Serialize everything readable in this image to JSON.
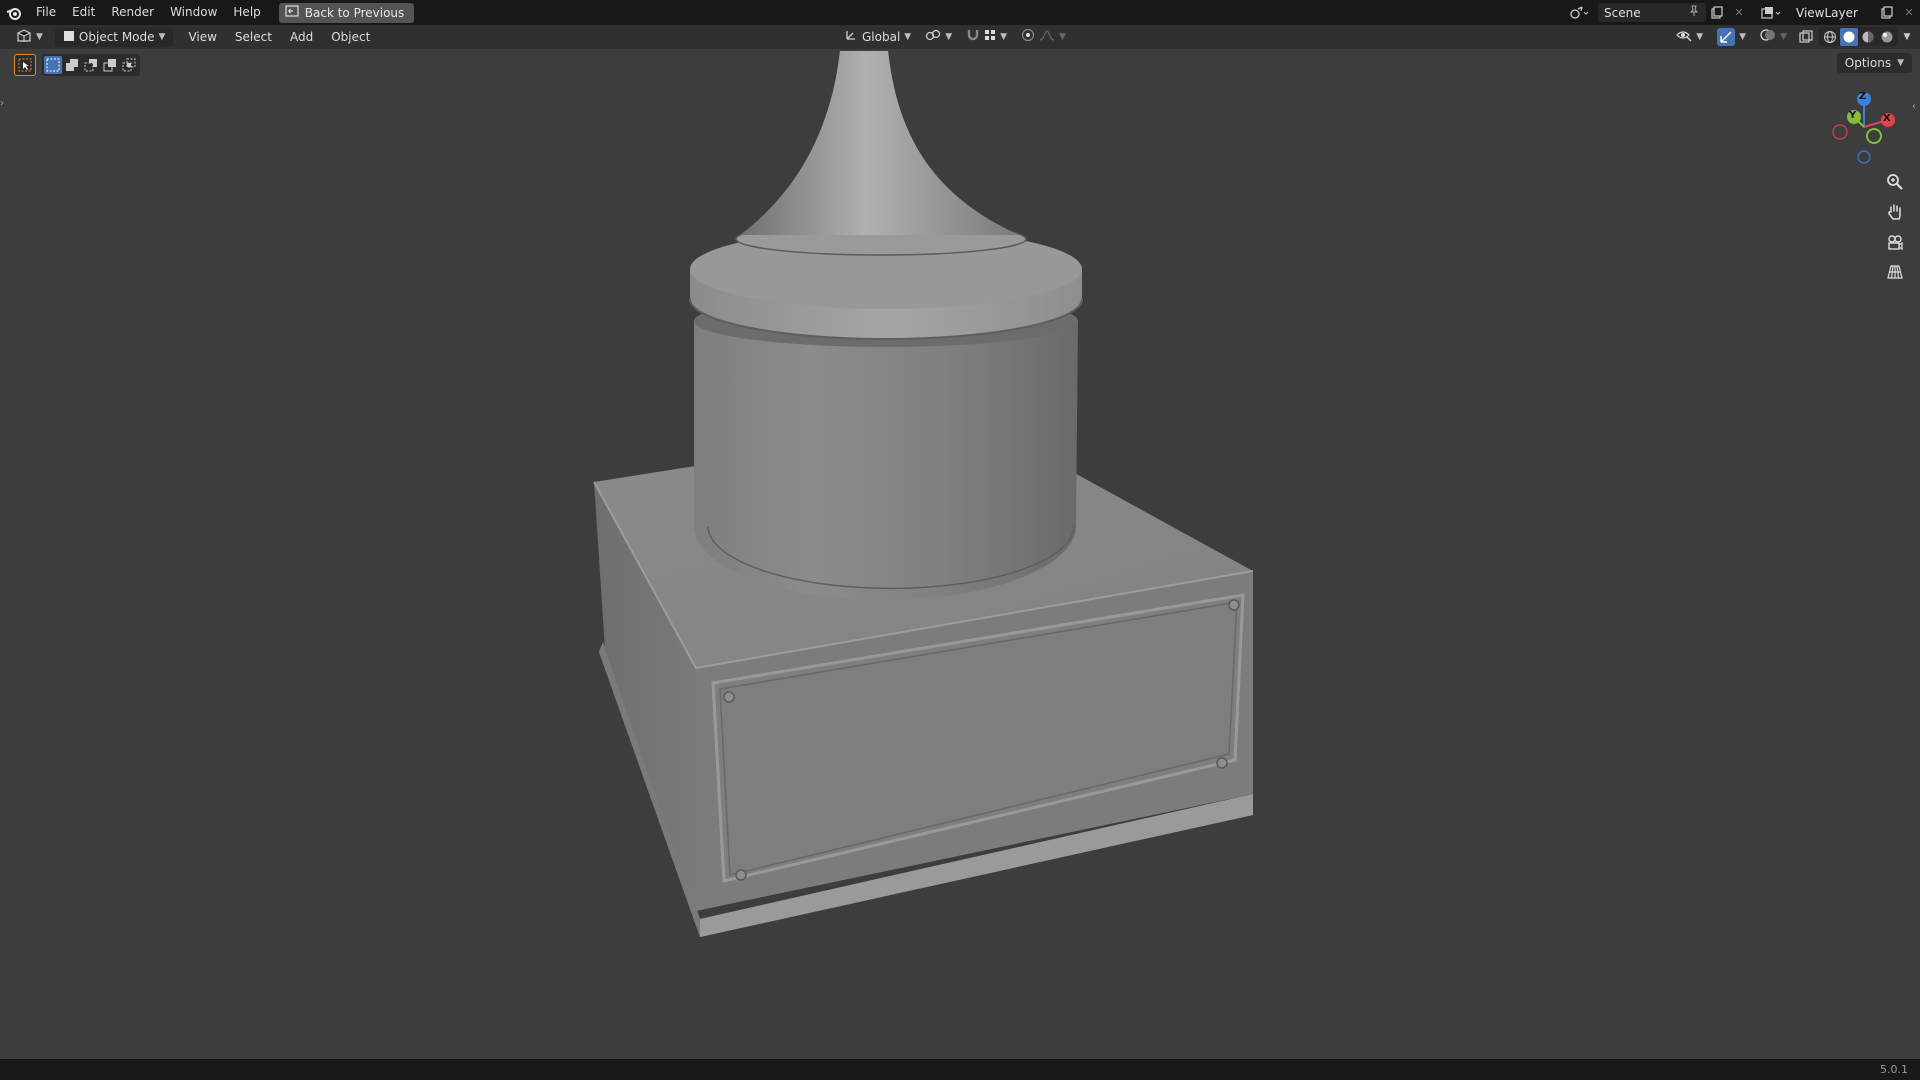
{
  "topbar": {
    "menus": [
      "File",
      "Edit",
      "Render",
      "Window",
      "Help"
    ],
    "back_button": "Back to Previous",
    "scene": "Scene",
    "view_layer": "ViewLayer"
  },
  "header": {
    "mode": "Object Mode",
    "menus": [
      "View",
      "Select",
      "Add",
      "Object"
    ],
    "transform_orientation": "Global"
  },
  "viewport": {
    "options_label": "Options",
    "gizmo": {
      "x": "X",
      "y": "Y",
      "z": "Z"
    }
  },
  "statusbar": {
    "version": "5.0.1"
  },
  "colors": {
    "accent": "#4772b3",
    "axis_x": "#e2434f",
    "axis_y": "#84bd3a",
    "axis_z": "#3e80d8",
    "viewport_bg": "#3d3d3d"
  }
}
